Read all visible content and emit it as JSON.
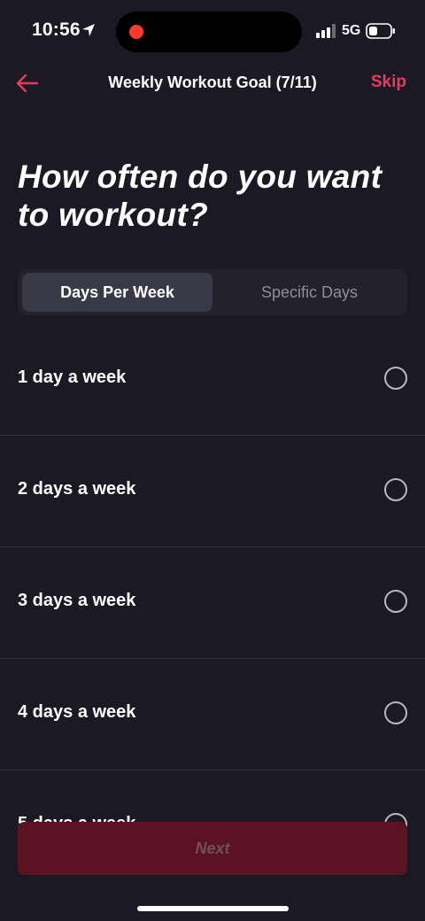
{
  "status_bar": {
    "time": "10:56",
    "network": "5G",
    "icons": [
      "location-arrow-icon",
      "recording-dot-icon",
      "signal-icon",
      "battery-icon"
    ]
  },
  "nav": {
    "title": "Weekly Workout Goal (7/11)",
    "skip_label": "Skip",
    "back_icon": "arrow-left-icon"
  },
  "question": "How often do you want to workout?",
  "segmented": {
    "tabs": [
      {
        "label": "Days Per Week",
        "active": true
      },
      {
        "label": "Specific Days",
        "active": false
      }
    ]
  },
  "options": [
    {
      "label": "1 day a week",
      "selected": false
    },
    {
      "label": "2 days a week",
      "selected": false
    },
    {
      "label": "3 days a week",
      "selected": false
    },
    {
      "label": "4 days a week",
      "selected": false
    },
    {
      "label": "5 days a week",
      "selected": false
    }
  ],
  "next_label": "Next",
  "colors": {
    "background": "#1b1a24",
    "accent": "#e8395f",
    "next_disabled_bg": "#5b1222"
  }
}
